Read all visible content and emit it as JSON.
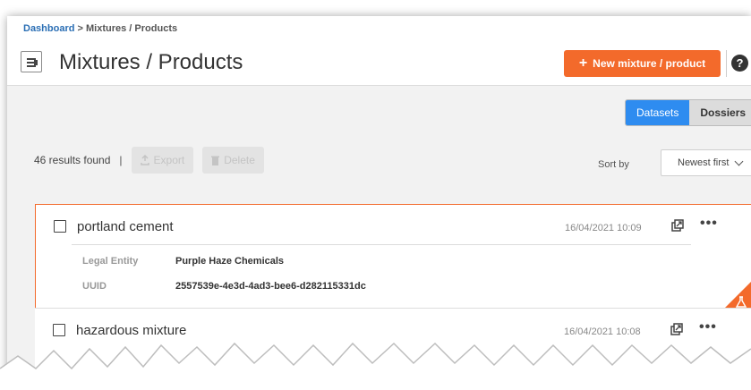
{
  "breadcrumb": {
    "root": "Dashboard",
    "sep": " > ",
    "current": "Mixtures / Products"
  },
  "header": {
    "title": "Mixtures / Products",
    "new_button": "New mixture / product",
    "help_glyph": "?"
  },
  "view_toggle": {
    "active": "Datasets",
    "inactive": "Dossiers"
  },
  "toolbar": {
    "results": "46 results found",
    "separator": "|",
    "export": "Export",
    "delete": "Delete",
    "sort_label": "Sort by",
    "sort_value": "Newest first"
  },
  "cards": [
    {
      "title": "portland cement",
      "timestamp": "16/04/2021 10:09",
      "fields": [
        {
          "label": "Legal Entity",
          "value": "Purple Haze Chemicals"
        },
        {
          "label": "UUID",
          "value": "2557539e-4e3d-4ad3-bee6-d282115331dc"
        }
      ]
    },
    {
      "title": "hazardous mixture",
      "timestamp": "16/04/2021 10:08"
    }
  ],
  "colors": {
    "accent": "#f36a2b",
    "primary": "#2e8cf0",
    "link": "#2a6eb4"
  },
  "icons": {
    "menu": "menu-toggle-icon",
    "help": "help-icon",
    "open": "open-external-icon",
    "more": "more-icon",
    "corner": "flask-icon"
  }
}
